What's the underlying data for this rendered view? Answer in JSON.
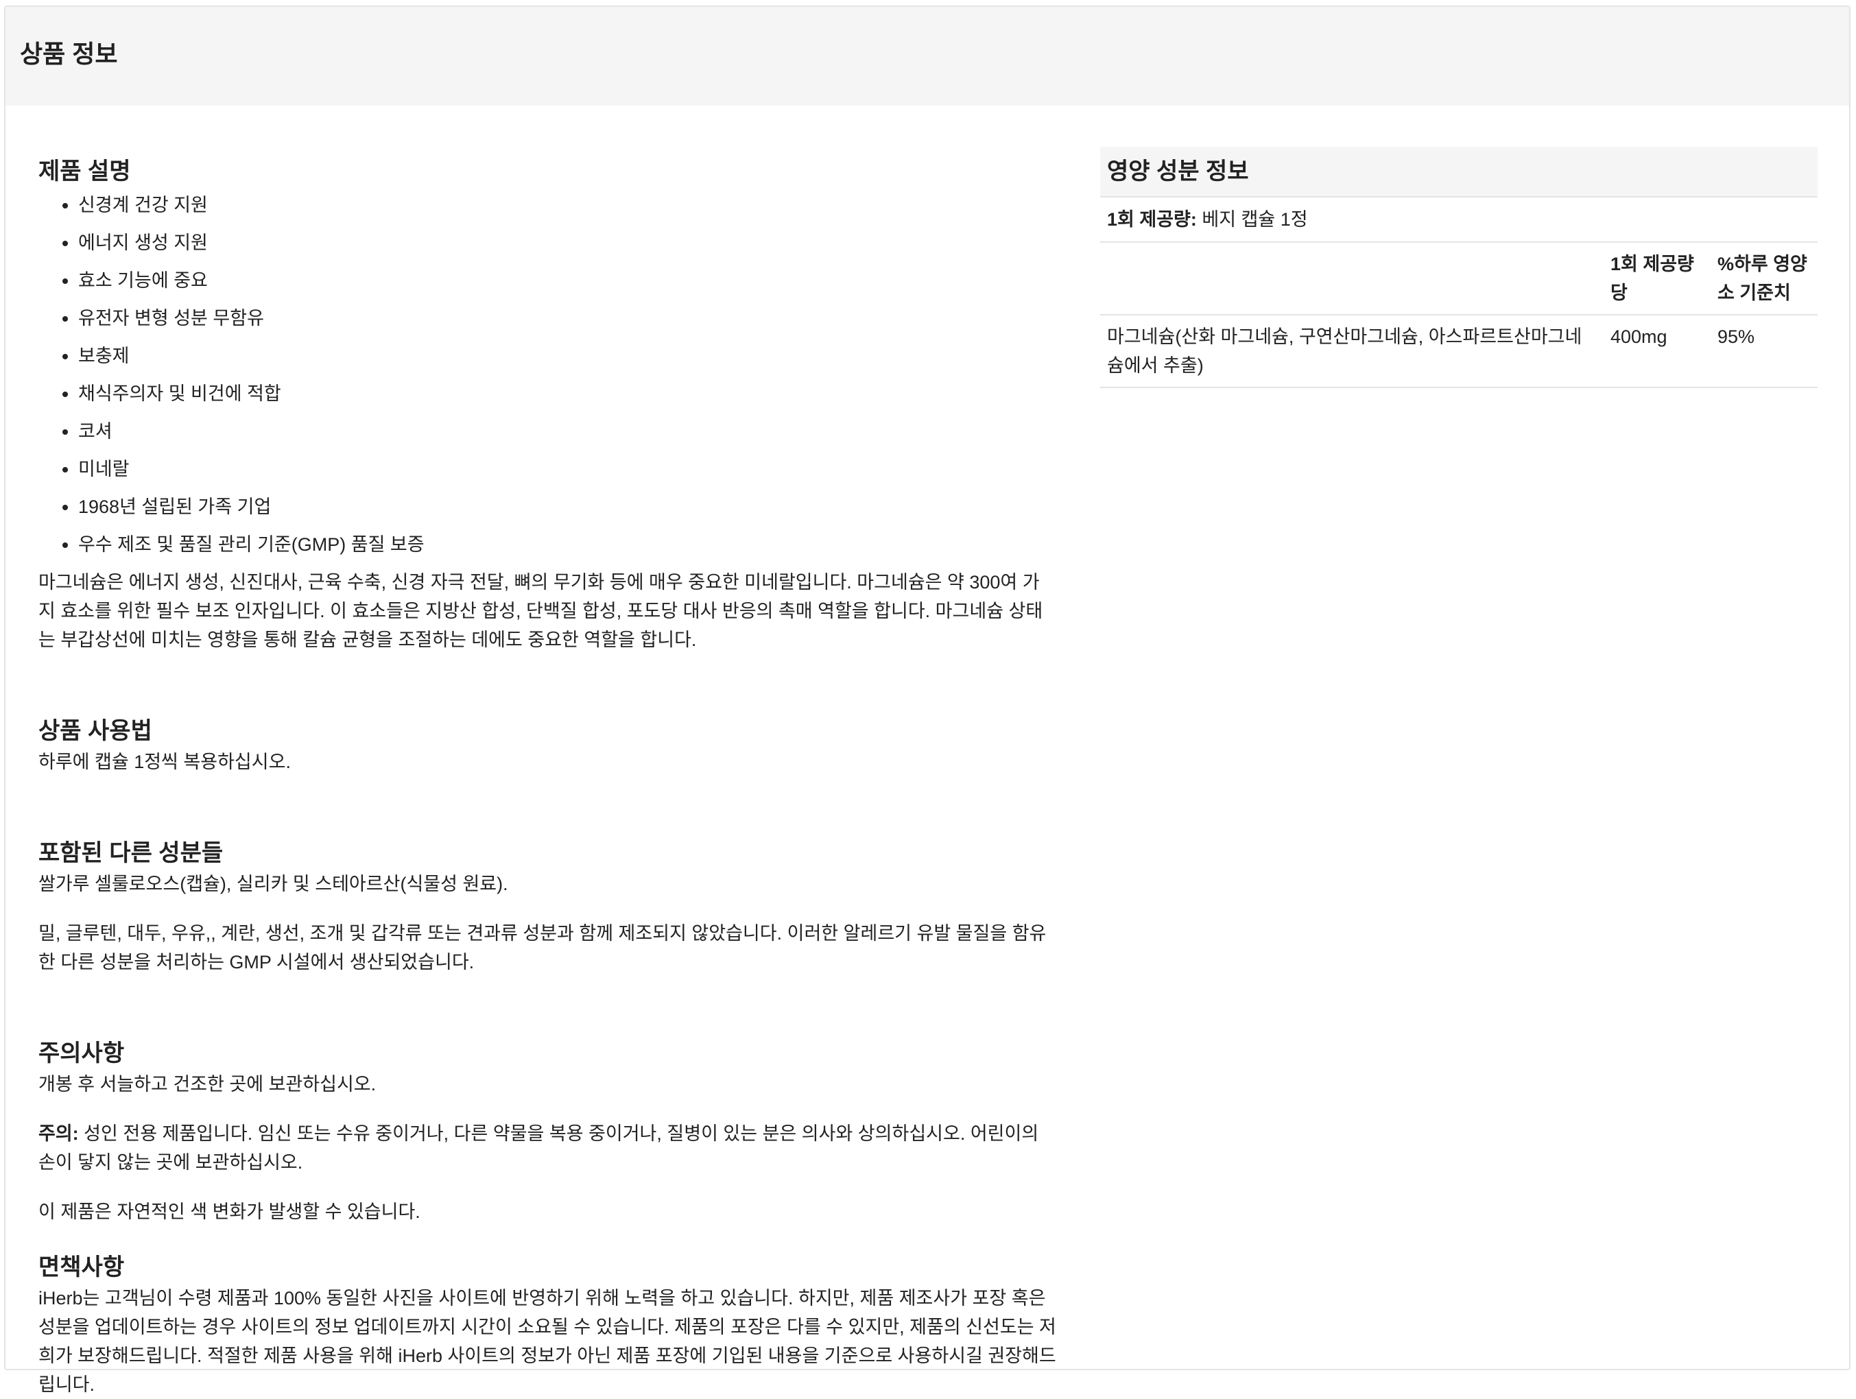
{
  "panel": {
    "title": "상품 정보"
  },
  "description": {
    "heading": "제품 설명",
    "bullets": [
      "신경계 건강 지원",
      "에너지 생성 지원",
      "효소 기능에 중요",
      "유전자 변형 성분 무함유",
      "보충제",
      "채식주의자 및 비건에 적합",
      "코셔",
      "미네랄",
      "1968년 설립된 가족 기업",
      "우수 제조 및 품질 관리 기준(GMP) 품질 보증"
    ],
    "paragraph": "마그네슘은 에너지 생성, 신진대사, 근육 수축, 신경 자극 전달, 뼈의 무기화 등에 매우 중요한 미네랄입니다. 마그네슘은 약 300여 가지 효소를 위한 필수 보조 인자입니다. 이 효소들은 지방산 합성, 단백질 합성, 포도당 대사 반응의 촉매 역할을 합니다. 마그네슘 상태는 부갑상선에 미치는 영향을 통해 칼슘 균형을 조절하는 데에도 중요한 역할을 합니다."
  },
  "usage": {
    "heading": "상품 사용법",
    "text": "하루에 캡슐 1정씩 복용하십시오."
  },
  "ingredients": {
    "heading": "포함된 다른 성분들",
    "text": "쌀가루 셀룰로오스(캡슐), 실리카 및 스테아르산(식물성 원료).",
    "allergen": "밀, 글루텐, 대두, 우유,, 계란, 생선, 조개 및 갑각류 또는 견과류 성분과 함께 제조되지 않았습니다. 이러한 알레르기 유발 물질을 함유한 다른 성분을 처리하는 GMP 시설에서 생산되었습니다."
  },
  "warnings": {
    "heading": "주의사항",
    "storage": "개봉 후 서늘하고 건조한 곳에 보관하십시오.",
    "caution_label": "주의:",
    "caution_text": " 성인 전용 제품입니다. 임신 또는 수유 중이거나, 다른 약물을 복용 중이거나, 질병이 있는 분은 의사와 상의하십시오. 어린이의 손이 닿지 않는 곳에 보관하십시오.",
    "color_note": "이 제품은 자연적인 색 변화가 발생할 수 있습니다."
  },
  "disclaimer": {
    "heading": "면책사항",
    "text": "iHerb는 고객님이 수령 제품과 100% 동일한 사진을 사이트에 반영하기 위해 노력을 하고 있습니다. 하지만, 제품 제조사가 포장 혹은 성분을 업데이트하는 경우 사이트의 정보 업데이트까지 시간이 소요될 수 있습니다. 제품의 포장은 다를 수 있지만, 제품의 신선도는 저희가 보장해드립니다. 적절한 제품 사용을 위해 iHerb 사이트의 정보가 아닌 제품 포장에 기입된 내용을 기준으로 사용하시길 권장해드립니다."
  },
  "nutrition": {
    "title": "영양 성분 정보",
    "serving_label": "1회 제공량:",
    "serving_value": " 베지 캡슐 1정",
    "columns": [
      "",
      "1회 제공량당",
      "%하루 영양소 기준치"
    ],
    "rows": [
      {
        "name": "마그네슘(산화 마그네슘, 구연산마그네슘, 아스파르트산마그네슘에서 추출)",
        "amount": "400mg",
        "dv": "95%"
      }
    ]
  }
}
